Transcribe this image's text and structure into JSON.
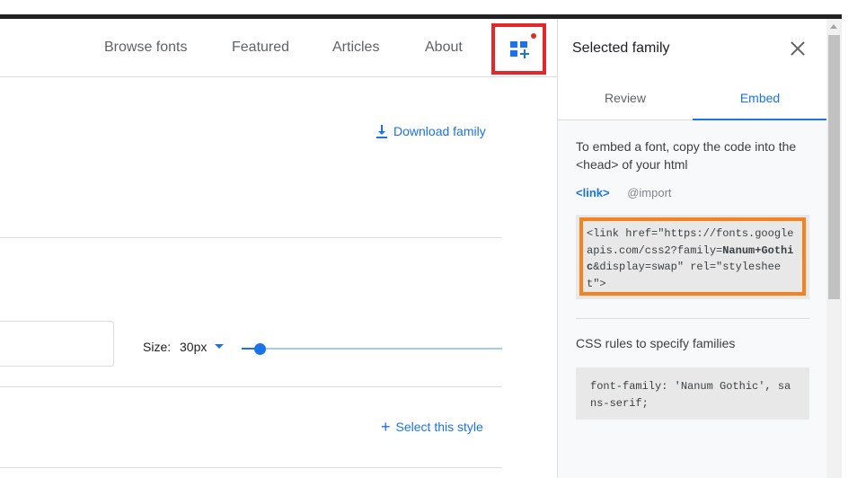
{
  "nav": {
    "links": [
      "Browse fonts",
      "Featured",
      "Articles",
      "About"
    ]
  },
  "main": {
    "download_label": "Download family",
    "size_label": "Size:",
    "size_value": "30px",
    "slider_fraction": 0.07,
    "select_style_label": "Select this style"
  },
  "panel": {
    "title": "Selected family",
    "tabs": [
      "Review",
      "Embed"
    ],
    "active_tab": "Embed",
    "instructions": "To embed a font, copy the code into the <head> of your html",
    "code_tabs": [
      "<link>",
      "@import"
    ],
    "code_prefix": "<link href=\"https://fonts.googleapis.com/css2?family=",
    "code_family": "Nanum+Gothic",
    "code_suffix": "&display=swap\" rel=\"stylesheet\">",
    "css_title": "CSS rules to specify families",
    "css_code": "font-family: 'Nanum Gothic', sans-serif;"
  },
  "colors": {
    "accent": "#1a73e8",
    "highlight_red": "#e3272b",
    "highlight_orange": "#f6821f"
  }
}
